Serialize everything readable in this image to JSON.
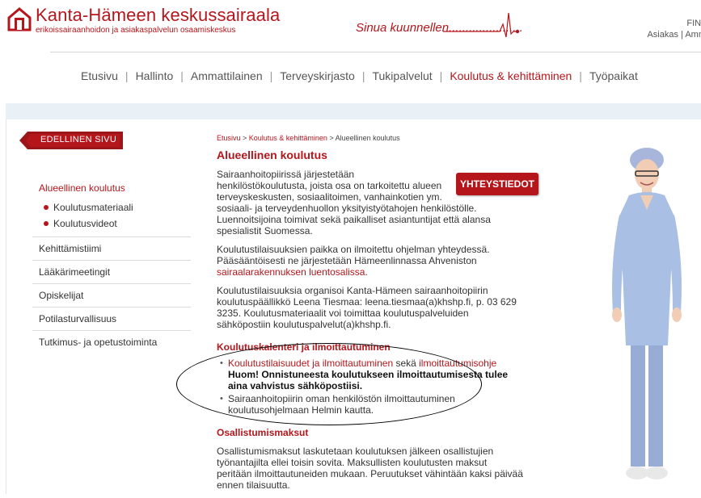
{
  "header": {
    "title": "Kanta-Hämeen keskussairaala",
    "subtitle": "erikoissairaanhoidon ja asiakaspalvelun osaamiskeskus",
    "slogan": "Sinua kuunnellen",
    "slogan_dots": "......................",
    "lang_line1": "FIN |",
    "lang_line2": "Asiakas | Amm",
    "brand_color": "#b5161c"
  },
  "topnav": {
    "items": [
      "Etusivu",
      "Hallinto",
      "Ammattilainen",
      "Terveyskirjasto",
      "Tukipalvelut",
      "Koulutus & kehittäminen",
      "Työpaikat"
    ],
    "separator": "|",
    "active_index": 5
  },
  "back_button": {
    "label": "EDELLINEN SIVU"
  },
  "sidebar": {
    "heading": "Alueellinen koulutus",
    "sub_items": [
      "Koulutusmateriaali",
      "Koulutusvideot"
    ],
    "items": [
      "Kehittämistiimi",
      "Lääkärimeetingit",
      "Opiskelijat",
      "Potilasturvallisuus",
      "Tutkimus- ja opetustoiminta"
    ]
  },
  "breadcrumb": {
    "home": "Etusivu",
    "sep": " > ",
    "section": "Koulutus & kehittäminen",
    "current": "Alueellinen koulutus"
  },
  "main": {
    "title": "Alueellinen koulutus",
    "contact_button": "YHTEYSTIEDOT",
    "p1_line1": "Sairaanhoitopiirissä järjestetään",
    "p1_line2": "henkilöstökoulutusta, joista osa on tarkoitettu alueen",
    "p1_line3": "terveyskeskusten, sosiaalitoimen, vanhainkotien ym.",
    "p1_line4": "sosiaali- ja terveydenhuollon yksityistyötahojen henkilöstölle. Luennoitsijoina toimivat sekä paikalliset asiantuntijat että alansa spesialistit Suomessa.",
    "p2_text": "Koulutustilaisuuksien paikka on ilmoitettu ohjelman yhteydessä. Pääsääntöisesti ne järjestetään Hämeenlinnassa Ahveniston",
    "p2_link": "sairaalarakennuksen luentosalissa",
    "p2_end": ".",
    "p3": "Koulutustilaisuuksia organisoi Kanta-Hämeen sairaanhoitopiirin koulutuspäällikkö Leena Tiesmaa: leena.tiesmaa(a)khshp.fi, p. 03 629 3235. Koulutusmateriaalit voi toimittaa koulutuspalveluiden sähköpostiin koulutuspalvelut(a)khshp.fi.",
    "h2_calendar": "Koulutuskalenteri ja ilmoittautuminen",
    "bullet1_link1": "Koulutustilaisuudet ja ilmoittautuminen",
    "bullet1_mid": " sekä ",
    "bullet1_link2": "ilmoittautumisohje",
    "bullet1_bold": "Huom! Onnistuneesta koulutukseen ilmoittautumisesta tulee aina vahvistus sähköpostiisi.",
    "bullet2": "Sairaanhoitopiirin oman henkilöstön ilmoittautuminen koulutusohjelmaan Helmin kautta.",
    "h2_fees": "Osallistumismaksut",
    "p4": "Osallistumismaksut laskutetaan koulutuksen jälkeen osallistujien työnantajilta ellei toisin sovita. Maksullisten koulutusten maksut peritään ilmoittautuneiden mukaan. Peruutukset vähintään kaksi päivää ennen tilaisuutta."
  }
}
